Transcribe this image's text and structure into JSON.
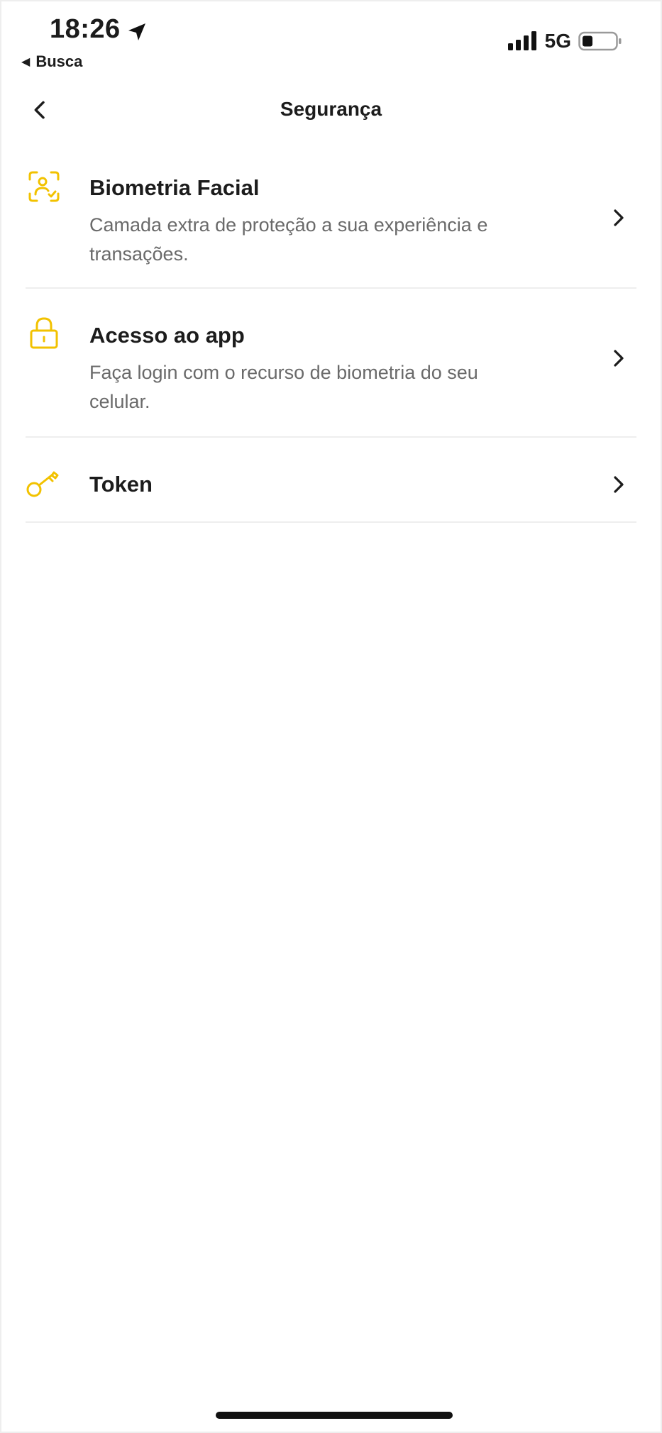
{
  "status_bar": {
    "time": "18:26",
    "back_app_label": "Busca",
    "network": "5G",
    "icons": [
      "location-arrow-icon",
      "signal-bars-icon",
      "battery-low-icon"
    ]
  },
  "header": {
    "title": "Segurança",
    "back_icon": "chevron-left-icon"
  },
  "settings": {
    "items": [
      {
        "title": "Biometria Facial",
        "description": "Camada extra de proteção a sua experiência e transações.",
        "icon": "face-scan-icon"
      },
      {
        "title": "Acesso ao app",
        "description": "Faça login com o recurso de biometria do seu celular.",
        "icon": "lock-icon"
      },
      {
        "title": "Token",
        "description": "",
        "icon": "key-icon"
      }
    ]
  },
  "colors": {
    "accent": "#F2C200",
    "text_primary": "#1C1C1C",
    "text_secondary": "#6A6A6A",
    "divider": "#EEEEEE",
    "background": "#FFFFFF"
  }
}
